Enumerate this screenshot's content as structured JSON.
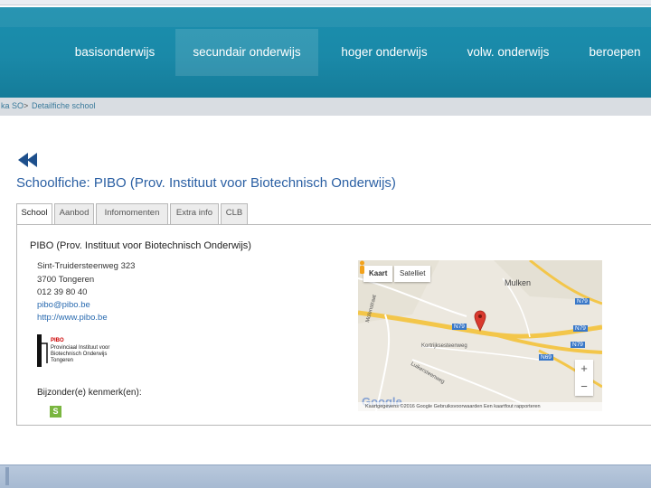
{
  "nav": {
    "items": [
      {
        "label": "basisonderwijs"
      },
      {
        "label": "secundair onderwijs"
      },
      {
        "label": "hoger onderwijs"
      },
      {
        "label": "volw. onderwijs"
      },
      {
        "label": "beroepen"
      }
    ]
  },
  "breadcrumb": {
    "item1": "ka SO",
    "sep": ">",
    "item2": "Detailfiche school"
  },
  "page": {
    "title": "Schoolfiche: PIBO (Prov. Instituut voor Biotechnisch Onderwijs)"
  },
  "tabs": [
    {
      "label": "School"
    },
    {
      "label": "Aanbod"
    },
    {
      "label": "Infomomenten"
    },
    {
      "label": "Extra info"
    },
    {
      "label": "CLB"
    }
  ],
  "school": {
    "name": "PIBO (Prov. Instituut voor Biotechnisch Onderwijs)",
    "street": "Sint-Truidersteenweg 323",
    "city": "3700 Tongeren",
    "phone": "012 39 80 40",
    "email": "pibo@pibo.be",
    "website": "http://www.pibo.be",
    "special_label": "Bijzonder(e) kenmerk(en):",
    "special_badge": "S"
  },
  "logo": {
    "brand": "PIBO",
    "line1": "Provinciaal Instituut voor",
    "line2": "Biotechnisch Onderwijs",
    "line3": "Tongeren"
  },
  "map": {
    "btn_map": "Kaart",
    "btn_satellite": "Satelliet",
    "place1": "Mulken",
    "road1": "N79",
    "road2": "N79",
    "road3": "N79",
    "road4": "N69",
    "road5": "N79",
    "street1": "Molenstraat",
    "street2": "Luikersteenweg",
    "street3": "Kortrijksesteenweg",
    "zoom_in": "+",
    "zoom_out": "−",
    "google": "Google",
    "attribution": "Kaartgegevens ©2016 Google   Gebruiksvoorwaarden   Een kaartfout rapporteren",
    "colors": {
      "road_major": "#f3c64a",
      "road_minor": "#ffffff",
      "land": "#ece8df",
      "marker": "#d93a2f"
    }
  },
  "icons": {
    "back": "double-left-arrow-icon",
    "pegman": "pegman-icon",
    "marker": "map-marker-icon"
  }
}
